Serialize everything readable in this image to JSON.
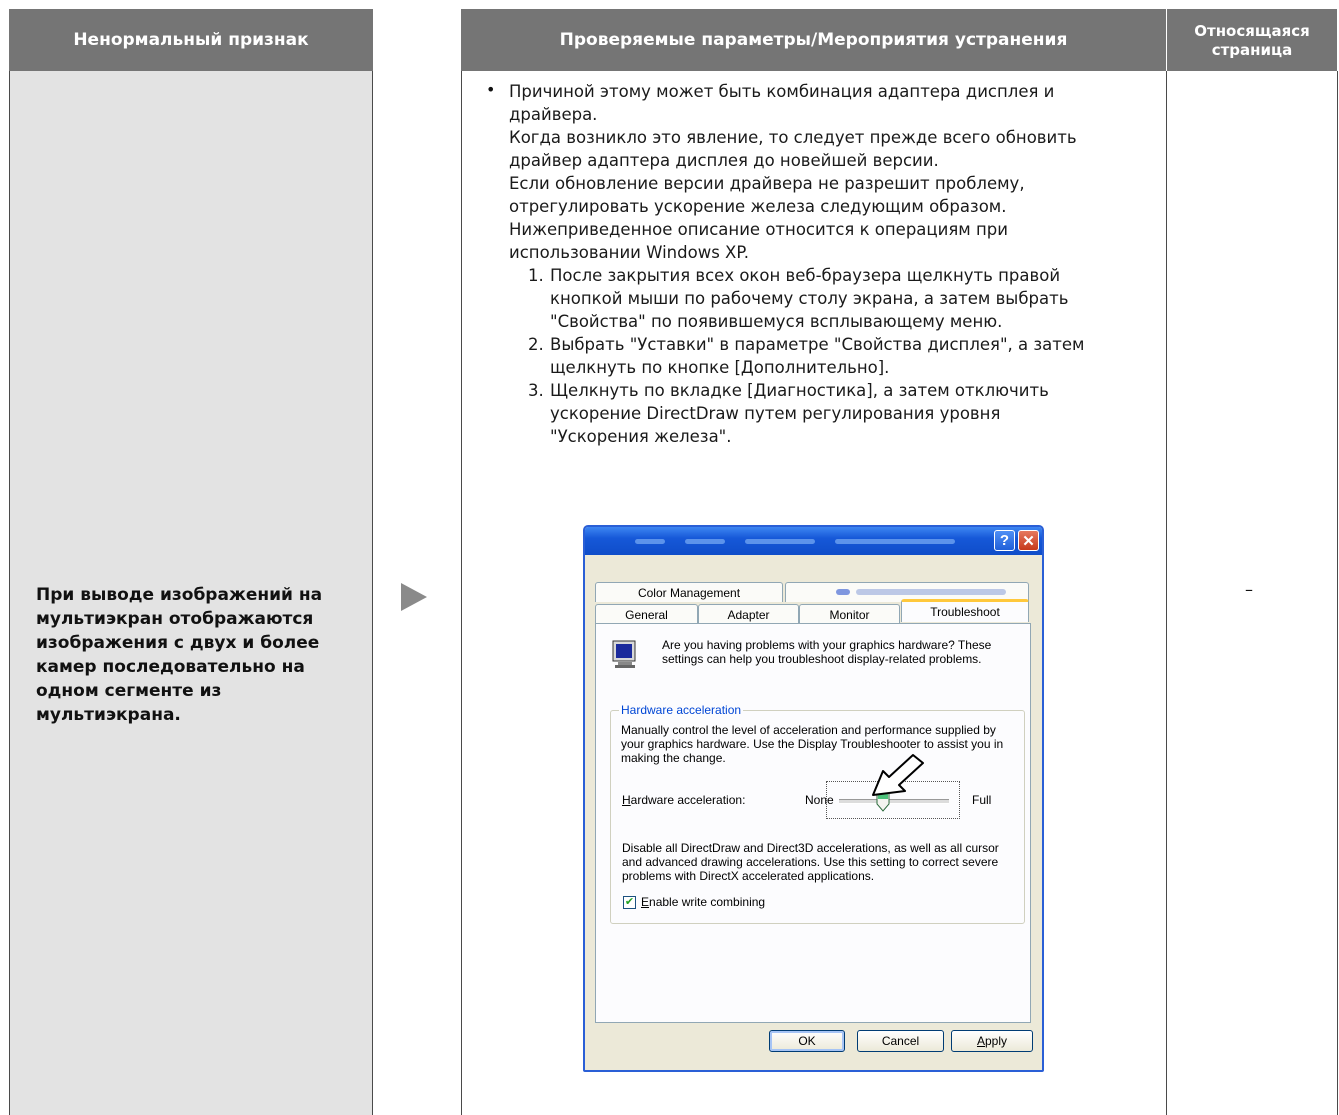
{
  "header": {
    "col_symptom": "Ненормальный признак",
    "col_params": "Проверяемые параметры/Мероприятия устранения",
    "col_page": "Относящаяся страница"
  },
  "symptom_text": "При выводе изображений на мультиэкран отображаются изображения с двух и более камер последовательно на одном сегменте из мультиэкрана.",
  "page_ref": "–",
  "remedy": {
    "bullet": "•",
    "intro_lines": [
      "Причиной этому может быть комбинация адаптера дисплея и",
      "драйвера.",
      "Когда возникло это явление, то следует прежде всего обновить",
      "драйвер адаптера дисплея до новейшей версии.",
      "Если обновление версии драйвера не разрешит проблему,",
      "отрегулировать ускорение железа следующим образом.",
      "Нижеприведенное описание относится к операциям при",
      "использовании Windows XP."
    ],
    "steps": [
      {
        "num": "1.",
        "lines": [
          "После закрытия всех окон веб-браузера щелкнуть правой",
          "кнопкой мыши по рабочему столу экрана, а затем выбрать",
          "\"Свойства\" по появившемуся всплывающему меню."
        ]
      },
      {
        "num": "2.",
        "lines": [
          "Выбрать \"Уставки\" в параметре \"Свойства дисплея\", а затем",
          "щелкнуть по кнопке [Дополнительно]."
        ]
      },
      {
        "num": "3.",
        "lines": [
          "Щелкнуть по вкладке [Диагностика], а затем отключить",
          "ускорение DirectDraw путем регулирования уровня",
          "\"Ускорения железа\"."
        ]
      }
    ]
  },
  "dialog": {
    "help_btn": "?",
    "close_btn": "✕",
    "tabs_row1": [
      "Color Management"
    ],
    "tabs_row2": [
      "General",
      "Adapter",
      "Monitor",
      "Troubleshoot"
    ],
    "active_tab": "Troubleshoot",
    "intro": "Are you having problems with your graphics hardware? These settings can help you troubleshoot display-related problems.",
    "group_label": "Hardware acceleration",
    "group_desc": "Manually control the level of acceleration and performance supplied by your graphics hardware. Use the Display Troubleshooter to assist you in making the change.",
    "slider_label_first": "H",
    "slider_label_rest": "ardware acceleration:",
    "slider_min": "None",
    "slider_max": "Full",
    "slider_level": 0.4,
    "disable_text": "Disable all DirectDraw and Direct3D accelerations, as well as all cursor and advanced drawing accelerations. Use this setting to correct severe problems with DirectX accelerated applications.",
    "checkbox_first": "E",
    "checkbox_rest": "nable write combining",
    "checkbox_checked": true,
    "btn_ok": "OK",
    "btn_cancel": "Cancel",
    "btn_apply_first": "A",
    "btn_apply_rest": "pply"
  }
}
